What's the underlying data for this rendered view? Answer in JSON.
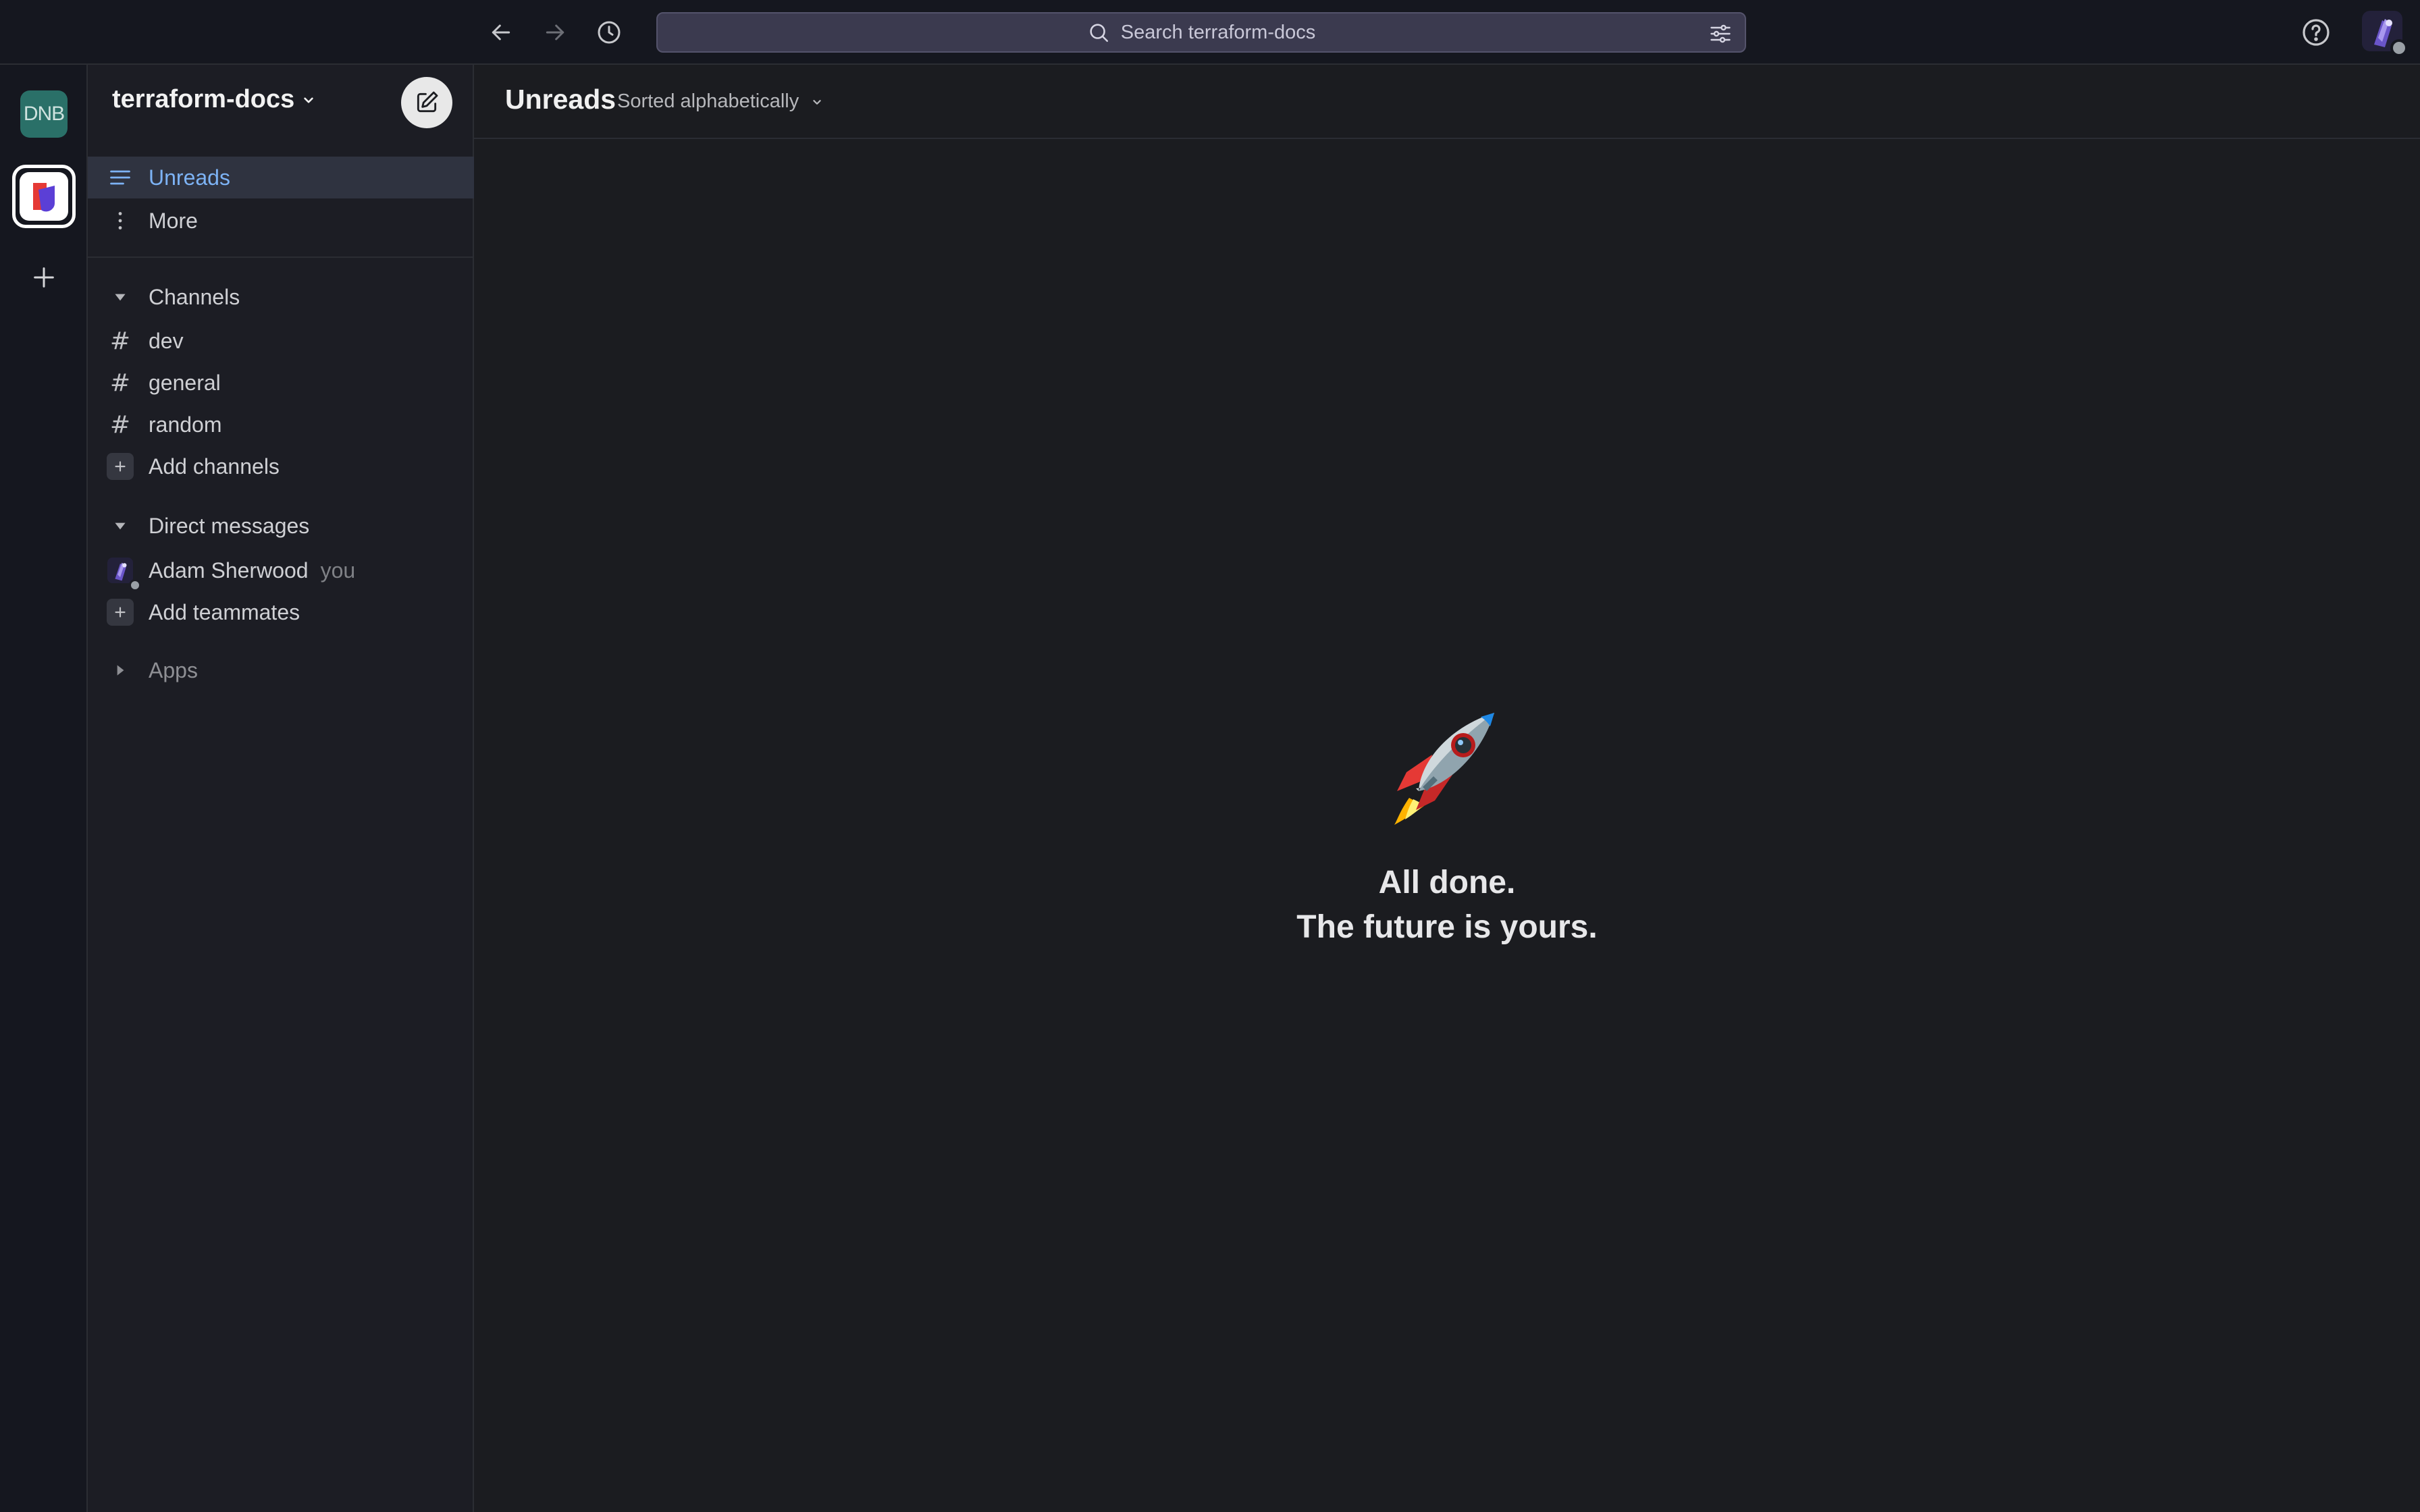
{
  "topbar": {
    "search_placeholder": "Search terraform-docs"
  },
  "rail": {
    "workspace_dnb_label": "DNB"
  },
  "sidebar": {
    "workspace_name": "terraform-docs",
    "nav": [
      {
        "label": "Unreads",
        "active": true
      },
      {
        "label": "More",
        "active": false
      }
    ],
    "channels_header": "Channels",
    "channels": [
      "dev",
      "general",
      "random"
    ],
    "add_channels": "Add channels",
    "dm_header": "Direct messages",
    "dm_user": "Adam Sherwood",
    "dm_you": "you",
    "add_teammates": "Add teammates",
    "apps_header": "Apps"
  },
  "main": {
    "title": "Unreads",
    "sort_label": "Sorted alphabetically",
    "empty_line1": "All done.",
    "empty_line2": "The future is yours."
  },
  "colors": {
    "accent": "#7db3f5",
    "active_row": "#2f3340",
    "workspace_dnb": "#2a7068"
  }
}
